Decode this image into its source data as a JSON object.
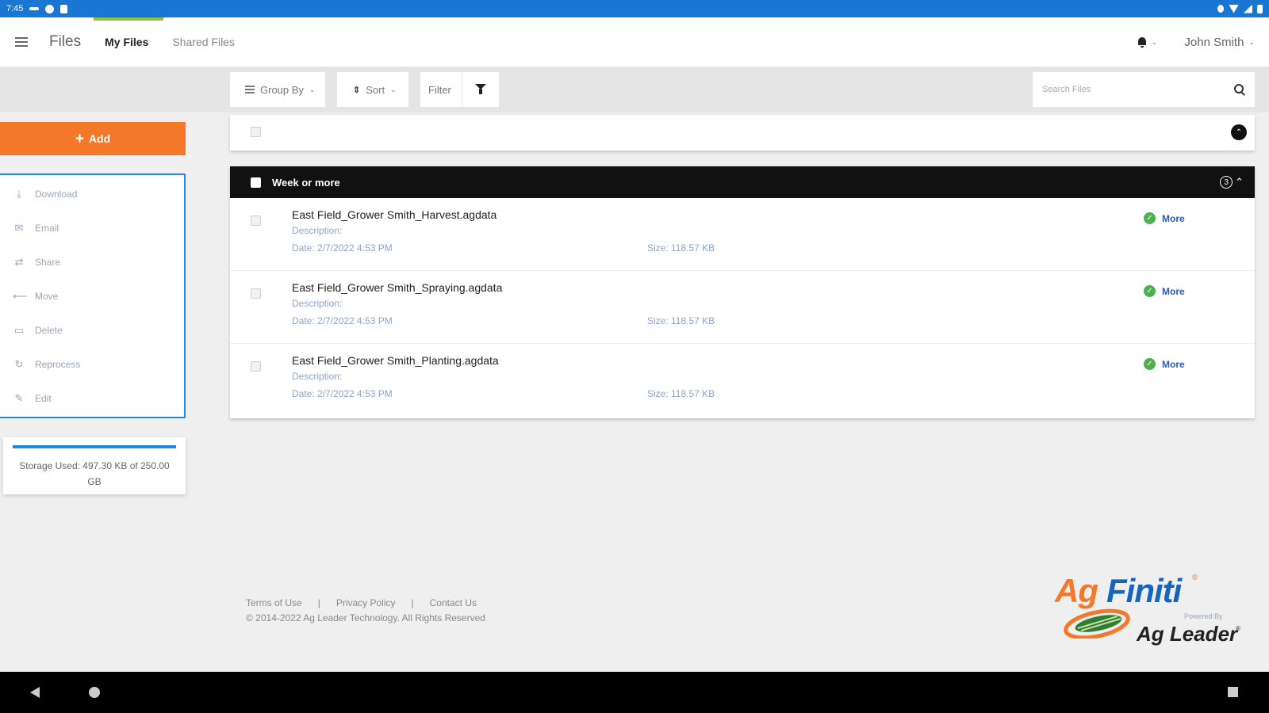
{
  "status_bar": {
    "time": "7:45"
  },
  "header": {
    "app_title": "Files",
    "tabs": [
      {
        "label": "My Files",
        "active": true
      },
      {
        "label": "Shared Files",
        "active": false
      }
    ],
    "user_name": "John Smith"
  },
  "toolbar": {
    "group_by_label": "Group By",
    "sort_label": "Sort",
    "filter_label": "Filter",
    "search_placeholder": "Search Files"
  },
  "sidebar": {
    "add_label": "Add",
    "actions": [
      {
        "label": "Download",
        "icon": "download-icon"
      },
      {
        "label": "Email",
        "icon": "email-icon"
      },
      {
        "label": "Share",
        "icon": "share-icon"
      },
      {
        "label": "Move",
        "icon": "move-icon"
      },
      {
        "label": "Delete",
        "icon": "trash-icon"
      },
      {
        "label": "Reprocess",
        "icon": "reprocess-icon"
      },
      {
        "label": "Edit",
        "icon": "pencil-icon"
      }
    ],
    "storage_text": "Storage Used: 497.30 KB of 250.00 GB",
    "storage_used_fraction": 2e-06
  },
  "group": {
    "title": "Week or more",
    "count": "3",
    "files": [
      {
        "name": "East Field_Grower Smith_Harvest.agdata",
        "description": "Description:",
        "date": "Date: 2/7/2022 4:53 PM",
        "size": "Size: 118.57 KB",
        "more": "More"
      },
      {
        "name": "East Field_Grower Smith_Spraying.agdata",
        "description": "Description:",
        "date": "Date: 2/7/2022 4:53 PM",
        "size": "Size: 118.57 KB",
        "more": "More"
      },
      {
        "name": "East Field_Grower Smith_Planting.agdata",
        "description": "Description:",
        "date": "Date: 2/7/2022 4:53 PM",
        "size": "Size: 118.57 KB",
        "more": "More"
      }
    ]
  },
  "footer": {
    "links": [
      "Terms of Use",
      "Privacy Policy",
      "Contact Us"
    ],
    "separator": "|",
    "copyright": "© 2014-2022 Ag Leader Technology. All Rights Reserved"
  },
  "logo": {
    "part1": "Ag",
    "part2": "Finiti",
    "reg": "®",
    "powered_by": "Powered By",
    "brand": "Ag Leader",
    "reg2": "®"
  },
  "colors": {
    "status_bar": "#1976d2",
    "accent_orange": "#f4782a",
    "accent_blue": "#1e88e5",
    "tab_indicator": "#8bc34a",
    "success_green": "#4caf50",
    "link_blue": "#2c5ab5"
  }
}
